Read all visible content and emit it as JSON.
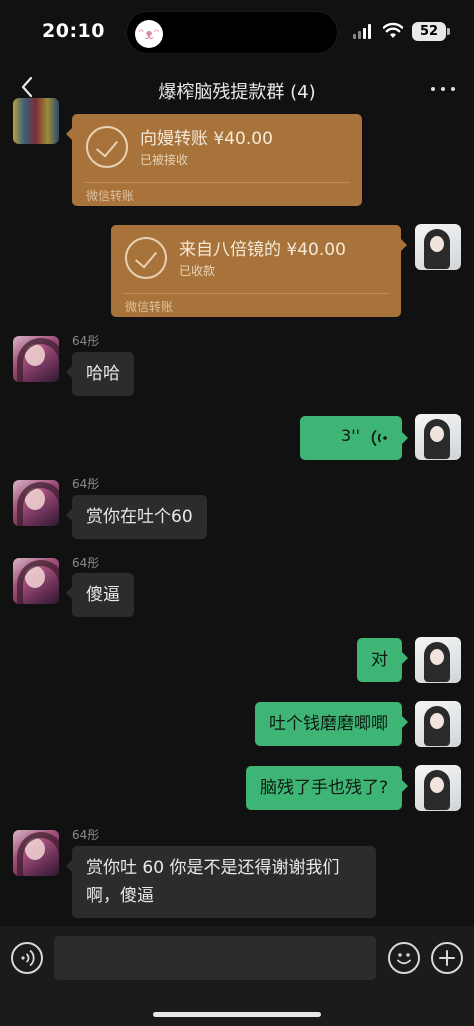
{
  "status_bar": {
    "time": "20:10",
    "battery": "52",
    "island_icon": "rabbit-icon"
  },
  "header": {
    "title": "爆榨脑残提款群 (4)",
    "back_icon": "chevron-left-icon",
    "more_icon": "ellipsis-icon"
  },
  "messages": [
    {
      "type": "transfer",
      "direction": "in",
      "amount": "向嫚转账 ¥40.00",
      "status": "已被接收",
      "footer": "微信转账"
    },
    {
      "type": "transfer",
      "direction": "out",
      "amount": "来自八倍镜的 ¥40.00",
      "status": "已收款",
      "footer": "微信转账"
    },
    {
      "type": "text",
      "direction": "in",
      "sender": "64彤",
      "text": "哈哈"
    },
    {
      "type": "voice",
      "direction": "out",
      "duration": "3''"
    },
    {
      "type": "text",
      "direction": "in",
      "sender": "64彤",
      "text": "赏你在吐个60"
    },
    {
      "type": "text",
      "direction": "in",
      "sender": "64彤",
      "text": "傻逼"
    },
    {
      "type": "text",
      "direction": "out",
      "text": "对"
    },
    {
      "type": "text",
      "direction": "out",
      "text": "吐个钱磨磨唧唧"
    },
    {
      "type": "text",
      "direction": "out",
      "text": "脑残了手也残了?"
    },
    {
      "type": "text",
      "direction": "in",
      "sender": "64彤",
      "text": "赏你吐 60 你是不是还得谢谢我们啊，傻逼"
    }
  ],
  "input_bar": {
    "voice_icon": "voice-mode-icon",
    "emoji_icon": "emoji-icon",
    "plus_icon": "plus-icon",
    "value": ""
  },
  "colors": {
    "background": "#111111",
    "bubble_in": "#2c2c2c",
    "bubble_out": "#3eb575",
    "transfer": "#a8733b"
  }
}
